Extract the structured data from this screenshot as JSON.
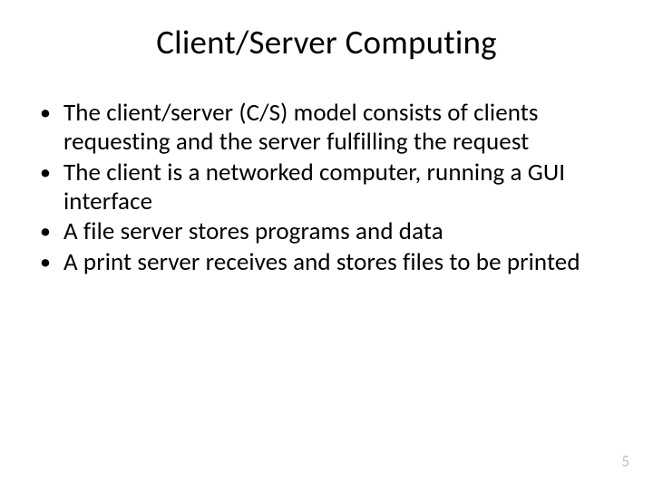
{
  "slide": {
    "title": "Client/Server Computing",
    "bullets": [
      "The client/server (C/S) model consists of clients requesting and the server fulfilling the request",
      "The client is a networked computer, running a GUI interface",
      "A file server stores programs and data",
      "A print server receives and stores files to be printed"
    ],
    "page_number": "5"
  }
}
